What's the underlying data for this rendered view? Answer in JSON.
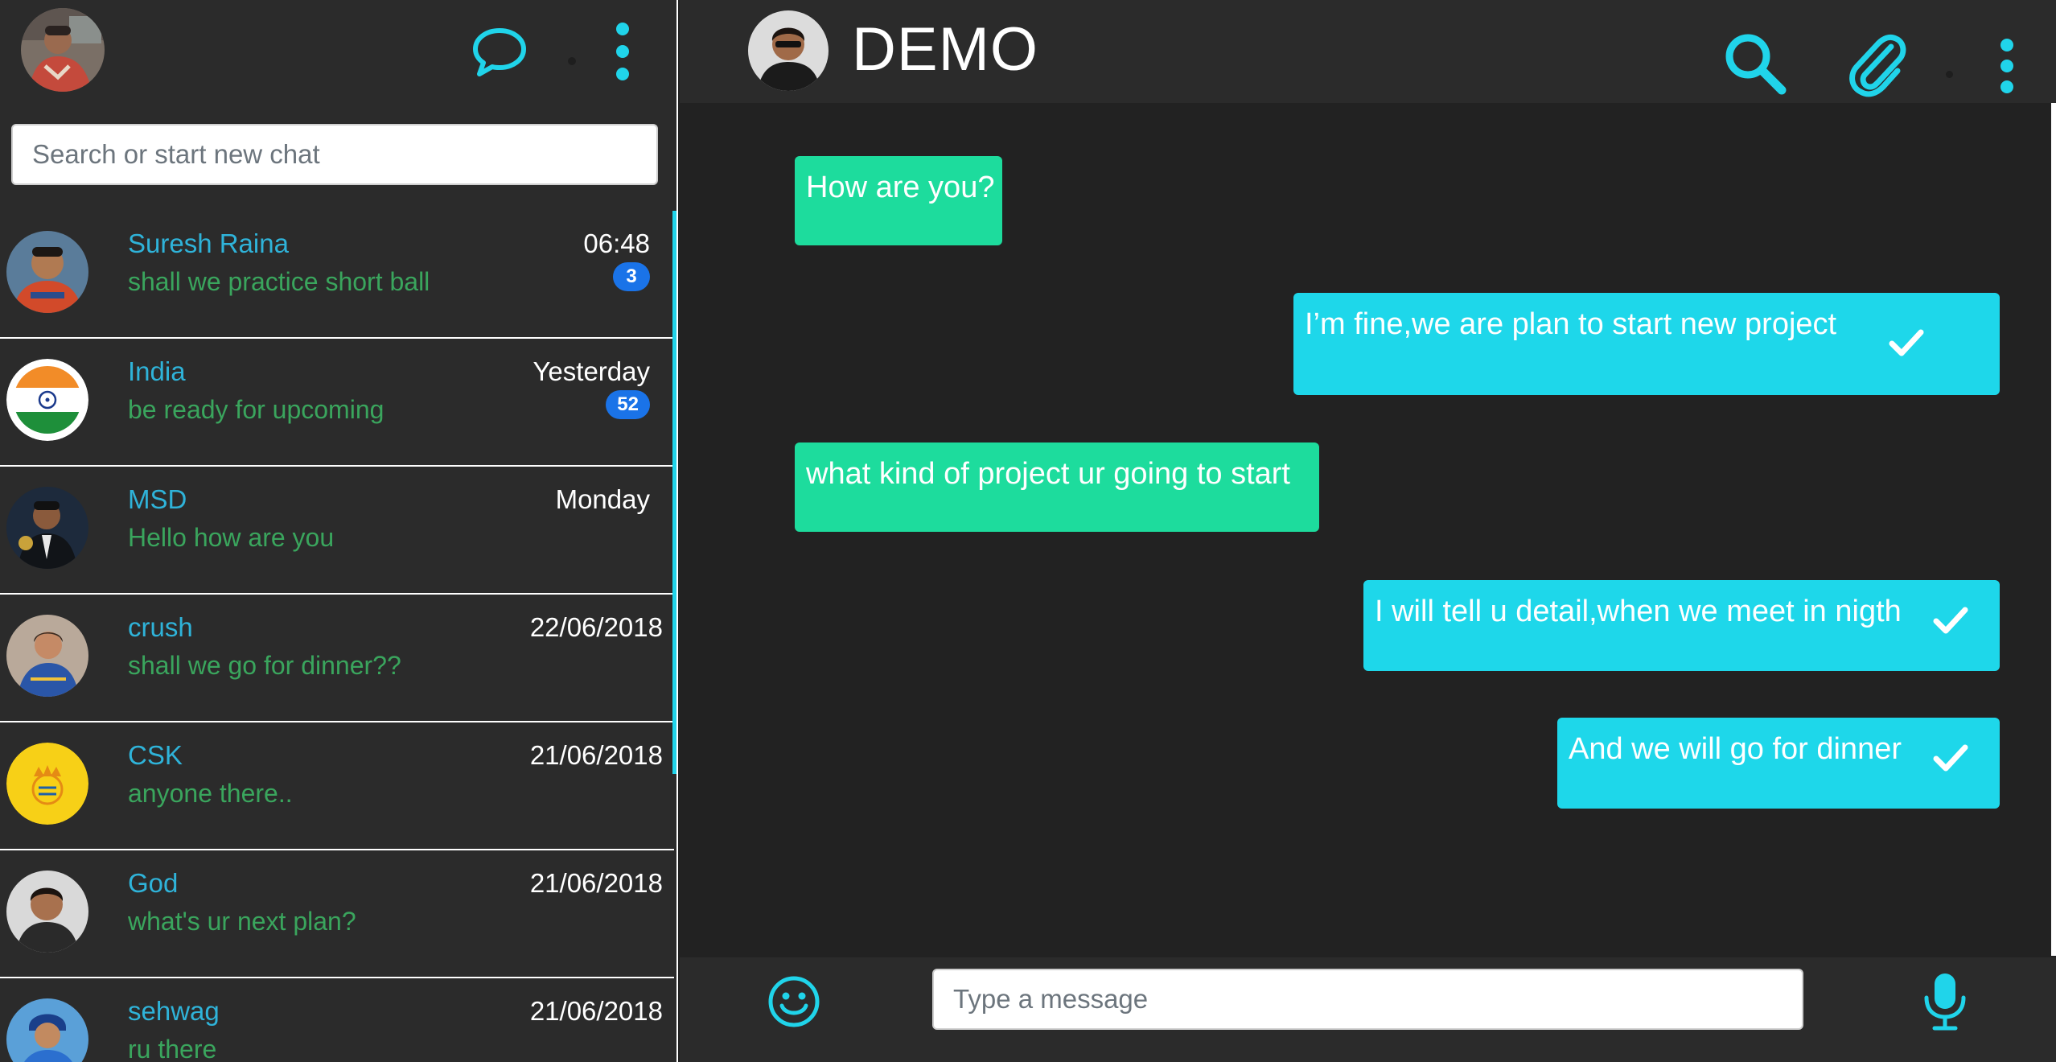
{
  "sidebar": {
    "search": {
      "placeholder": "Search or start new chat",
      "value": ""
    },
    "chats": [
      {
        "name": "Suresh Raina",
        "preview": "shall we practice short ball",
        "time": "06:48",
        "badge": "3"
      },
      {
        "name": "India",
        "preview": "be ready for upcoming",
        "time": "Yesterday",
        "badge": "52"
      },
      {
        "name": "MSD",
        "preview": "Hello how are you",
        "time": "Monday",
        "badge": ""
      },
      {
        "name": "crush",
        "preview": "shall we go for dinner??",
        "time": "22/06/2018",
        "badge": ""
      },
      {
        "name": "CSK",
        "preview": "anyone there..",
        "time": "21/06/2018",
        "badge": ""
      },
      {
        "name": "God",
        "preview": "what's ur next plan?",
        "time": "21/06/2018",
        "badge": ""
      },
      {
        "name": "sehwag",
        "preview": "ru there",
        "time": "21/06/2018",
        "badge": ""
      }
    ]
  },
  "conversation": {
    "contact_name": "DEMO",
    "messages": [
      {
        "direction": "in",
        "text": "How are you?"
      },
      {
        "direction": "out",
        "text": "I’m fine,we are plan to start new project",
        "status": "sent"
      },
      {
        "direction": "in",
        "text": "what kind of project ur going to start"
      },
      {
        "direction": "out",
        "text": "I will tell u detail,when we meet in nigth",
        "status": "sent"
      },
      {
        "direction": "out",
        "text": "And we will go for dinner",
        "status": "sent"
      }
    ],
    "composer": {
      "placeholder": "Type a message",
      "value": ""
    }
  },
  "icons": {
    "new_chat": "chat-bubble-icon",
    "sidebar_menu": "vertical-dots-icon",
    "search": "search-icon",
    "attach": "paperclip-icon",
    "conversation_menu": "vertical-dots-icon",
    "emoji": "smiley-icon",
    "mic": "microphone-icon",
    "message_status": "check-icon"
  },
  "colors": {
    "accent": "#20d4ea",
    "incoming_bubble": "#1ddc9d",
    "outgoing_bubble": "#1ed7ea",
    "contact_name": "#2fb3d9",
    "preview_text": "#3aa55d",
    "badge": "#1a73e8"
  }
}
